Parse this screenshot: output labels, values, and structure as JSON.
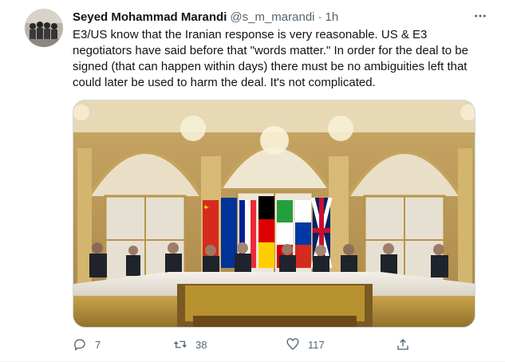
{
  "tweet": {
    "author": {
      "display_name": "Seyed Mohammad Marandi",
      "handle": "@s_m_marandi",
      "separator": "·",
      "time": "1h"
    },
    "text_lines": [
      "E3/US know that the Iranian response is very reasonable. US & E3",
      "negotiators have said before that \"words matter.\" In order for the deal to be",
      "signed (that can happen within days) there must be no ambiguities left that",
      "could later be used to harm the deal. It's not complicated."
    ],
    "media": {
      "type": "photo"
    },
    "actions": {
      "replies": "7",
      "retweets": "38",
      "likes": "117"
    }
  },
  "icons": {
    "more": "more-icon",
    "reply": "reply-icon",
    "retweet": "retweet-icon",
    "like": "like-icon",
    "share": "share-icon"
  },
  "colors": {
    "text": "#0f1419",
    "secondary": "#536471",
    "border": "#cfd9de"
  }
}
